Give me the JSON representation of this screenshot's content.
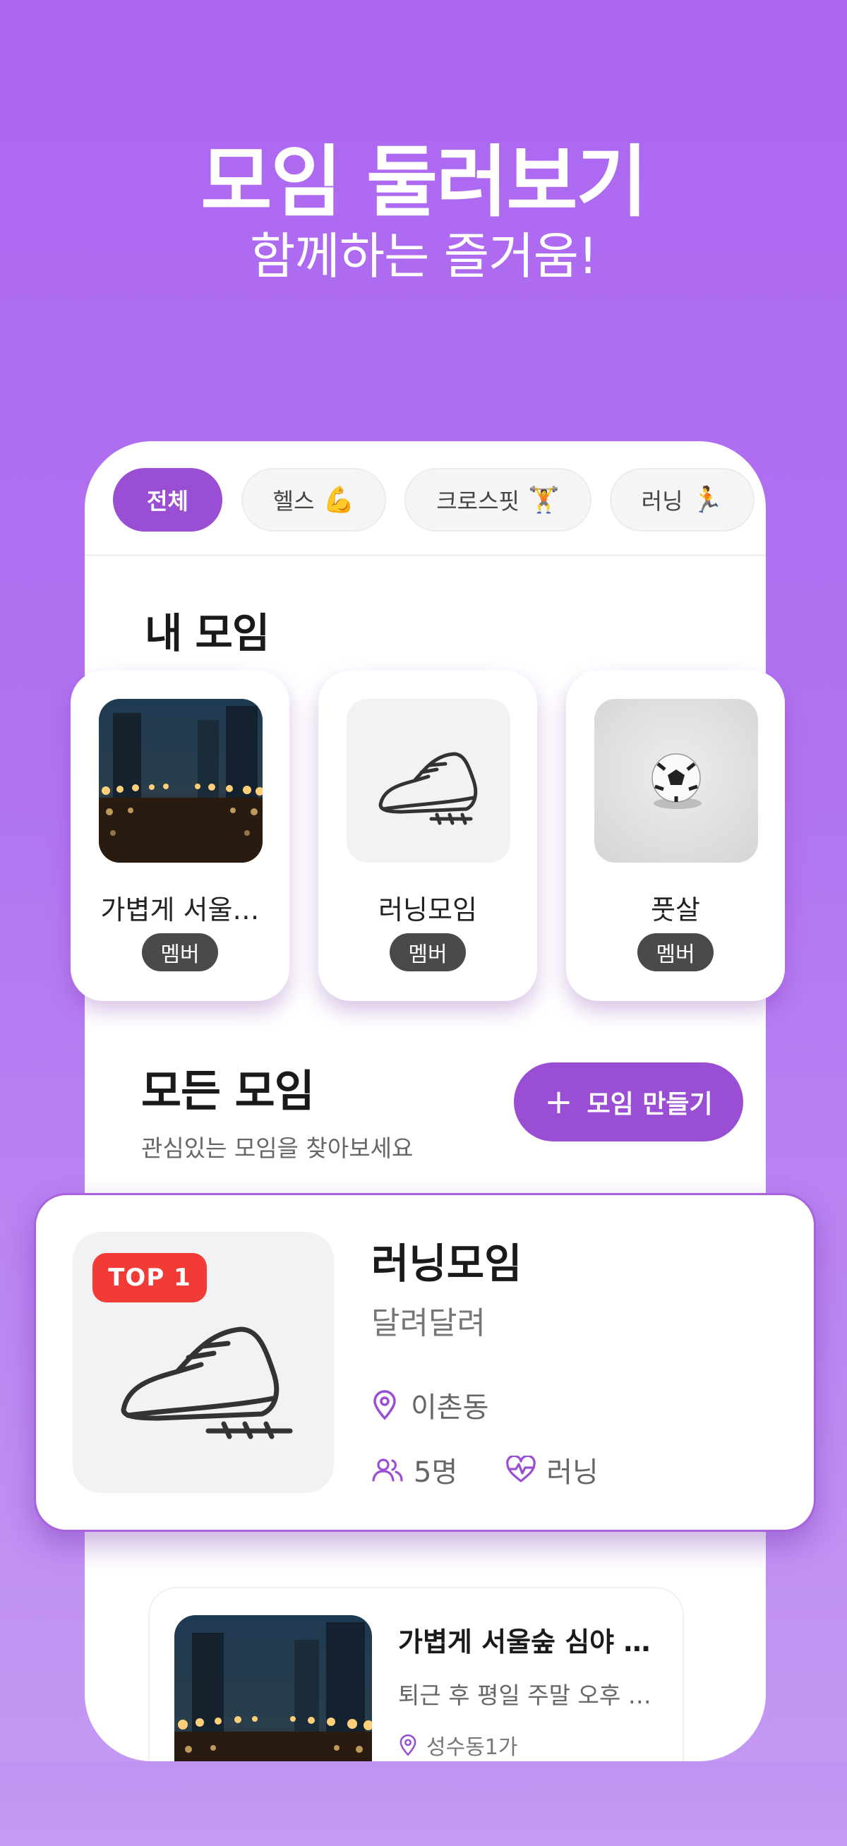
{
  "hero": {
    "title": "모임 둘러보기",
    "subtitle": "함께하는 즐거움!"
  },
  "categories": [
    {
      "label": "전체",
      "emoji": "",
      "active": true
    },
    {
      "label": "헬스",
      "emoji": "💪",
      "active": false
    },
    {
      "label": "크로스핏",
      "emoji": "🏋",
      "active": false
    },
    {
      "label": "러닝",
      "emoji": "🏃",
      "active": false
    }
  ],
  "my_groups": {
    "title": "내 모임",
    "items": [
      {
        "name": "가볍게 서울…",
        "badge": "멤버",
        "image": "city-night-lights"
      },
      {
        "name": "러닝모임",
        "badge": "멤버",
        "image": "running-shoe-icon"
      },
      {
        "name": "풋살",
        "badge": "멤버",
        "image": "soccer-ball"
      }
    ]
  },
  "all_groups": {
    "title": "모든 모임",
    "subtitle": "관심있는 모임을 찾아보세요",
    "create_label": "모임 만들기"
  },
  "featured": {
    "rank": "TOP 1",
    "name": "러닝모임",
    "description": "달려달려",
    "location": "이촌동",
    "members": "5명",
    "category": "러닝"
  },
  "list": [
    {
      "name": "가볍게 서울숲 심야 …",
      "description": "퇴근 후 평일 주말 오후 1…",
      "location": "성수동1가"
    }
  ],
  "colors": {
    "accent": "#9a4ed3",
    "top_badge": "#f23a36",
    "member_badge": "#4a4a4a"
  }
}
